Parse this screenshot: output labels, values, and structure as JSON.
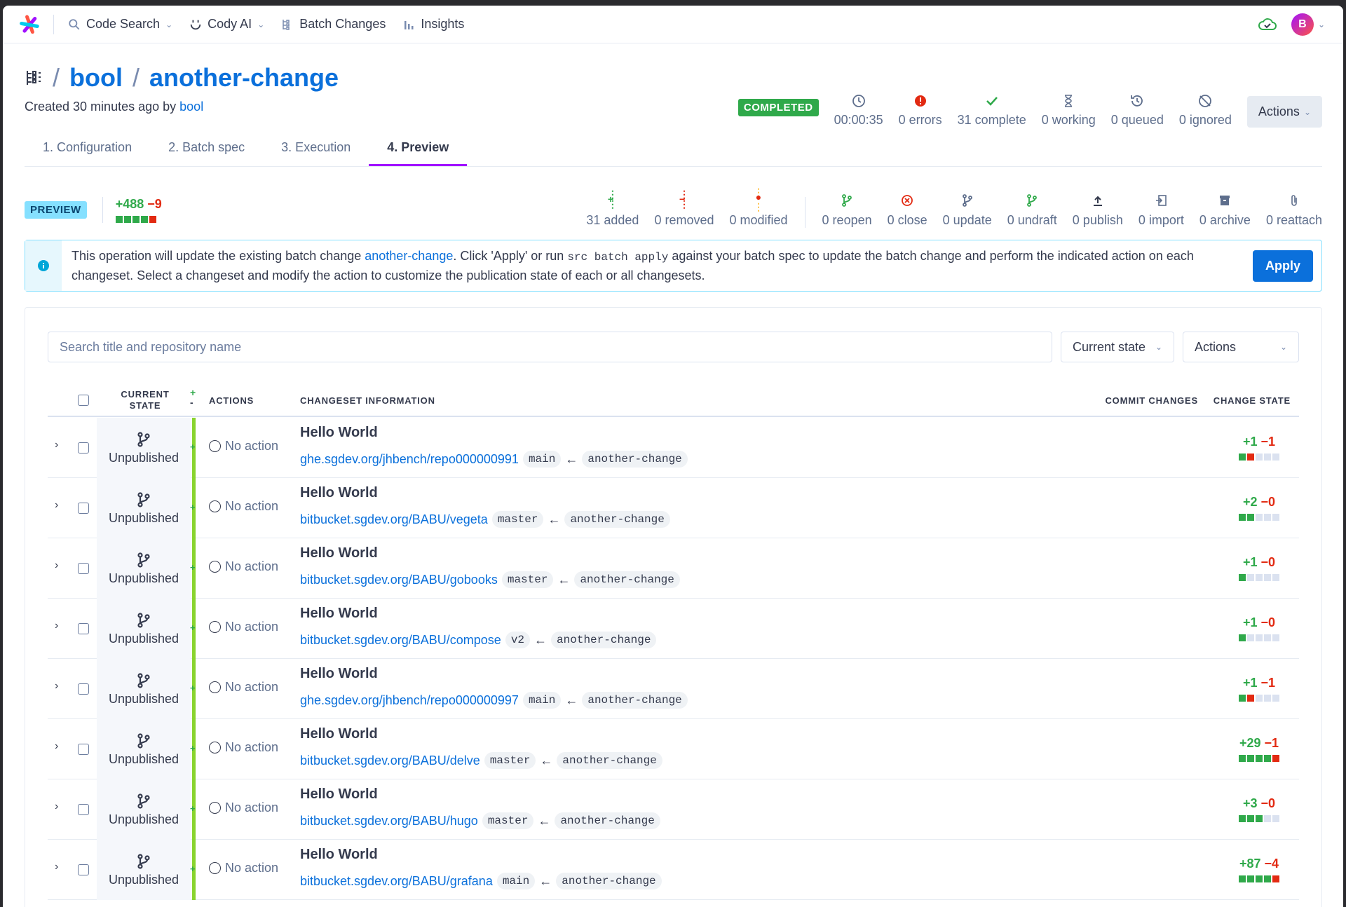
{
  "nav": {
    "items": [
      {
        "label": "Code Search",
        "icon": "search-icon",
        "dropdown": true
      },
      {
        "label": "Cody AI",
        "icon": "cody-icon",
        "dropdown": true
      },
      {
        "label": "Batch Changes",
        "icon": "batch-changes-icon",
        "dropdown": false
      },
      {
        "label": "Insights",
        "icon": "bar-chart-icon",
        "dropdown": false
      }
    ],
    "avatar_initial": "B"
  },
  "header": {
    "namespace": "bool",
    "name": "another-change",
    "created_prefix": "Created 30 minutes ago by",
    "created_by": "bool"
  },
  "execution": {
    "status": "COMPLETED",
    "duration": "00:00:35",
    "errors": "0 errors",
    "complete": "31 complete",
    "working": "0 working",
    "queued": "0 queued",
    "ignored": "0 ignored",
    "actions_label": "Actions"
  },
  "tabs": [
    "1. Configuration",
    "2. Batch spec",
    "3. Execution",
    "4. Preview"
  ],
  "active_tab": "4. Preview",
  "preview": {
    "badge": "PREVIEW",
    "added_lines": "+488",
    "removed_lines": "−9",
    "diffstat_blocks": [
      "g",
      "g",
      "g",
      "g",
      "r"
    ],
    "added": "31 added",
    "removed": "0 removed",
    "modified": "0 modified",
    "reopen": "0 reopen",
    "close": "0 close",
    "update": "0 update",
    "undraft": "0 undraft",
    "publish": "0 publish",
    "import": "0 import",
    "archive": "0 archive",
    "reattach": "0 reattach"
  },
  "alert": {
    "text1": "This operation will update the existing batch change ",
    "link": "another-change",
    "text2": ". Click 'Apply' or run ",
    "code": "src batch apply",
    "text3": " against your batch spec to update the batch change and perform the indicated action on each changeset. Select a changeset and modify the action to customize the publication state of each or all changesets.",
    "apply_label": "Apply"
  },
  "filters": {
    "search_placeholder": "Search title and repository name",
    "state_label": "Current state",
    "actions_label": "Actions"
  },
  "table": {
    "headers": {
      "current_state": "CURRENT STATE",
      "actions": "ACTIONS",
      "changeset_info": "CHANGESET INFORMATION",
      "commit_changes": "COMMIT CHANGES",
      "change_state": "CHANGE STATE"
    },
    "rows": [
      {
        "state": "Unpublished",
        "action": "No action",
        "title": "Hello World",
        "repo": "ghe.sgdev.org/jhbench/repo000000991",
        "base": "main",
        "head": "another-change",
        "added": "+1",
        "removed": "−1",
        "blocks": [
          "g",
          "r",
          "e",
          "e",
          "e"
        ]
      },
      {
        "state": "Unpublished",
        "action": "No action",
        "title": "Hello World",
        "repo": "bitbucket.sgdev.org/BABU/vegeta",
        "base": "master",
        "head": "another-change",
        "added": "+2",
        "removed": "−0",
        "blocks": [
          "g",
          "g",
          "e",
          "e",
          "e"
        ]
      },
      {
        "state": "Unpublished",
        "action": "No action",
        "title": "Hello World",
        "repo": "bitbucket.sgdev.org/BABU/gobooks",
        "base": "master",
        "head": "another-change",
        "added": "+1",
        "removed": "−0",
        "blocks": [
          "g",
          "e",
          "e",
          "e",
          "e"
        ]
      },
      {
        "state": "Unpublished",
        "action": "No action",
        "title": "Hello World",
        "repo": "bitbucket.sgdev.org/BABU/compose",
        "base": "v2",
        "head": "another-change",
        "added": "+1",
        "removed": "−0",
        "blocks": [
          "g",
          "e",
          "e",
          "e",
          "e"
        ]
      },
      {
        "state": "Unpublished",
        "action": "No action",
        "title": "Hello World",
        "repo": "ghe.sgdev.org/jhbench/repo000000997",
        "base": "main",
        "head": "another-change",
        "added": "+1",
        "removed": "−1",
        "blocks": [
          "g",
          "r",
          "e",
          "e",
          "e"
        ]
      },
      {
        "state": "Unpublished",
        "action": "No action",
        "title": "Hello World",
        "repo": "bitbucket.sgdev.org/BABU/delve",
        "base": "master",
        "head": "another-change",
        "added": "+29",
        "removed": "−1",
        "blocks": [
          "g",
          "g",
          "g",
          "g",
          "r"
        ]
      },
      {
        "state": "Unpublished",
        "action": "No action",
        "title": "Hello World",
        "repo": "bitbucket.sgdev.org/BABU/hugo",
        "base": "master",
        "head": "another-change",
        "added": "+3",
        "removed": "−0",
        "blocks": [
          "g",
          "g",
          "g",
          "e",
          "e"
        ]
      },
      {
        "state": "Unpublished",
        "action": "No action",
        "title": "Hello World",
        "repo": "bitbucket.sgdev.org/BABU/grafana",
        "base": "main",
        "head": "another-change",
        "added": "+87",
        "removed": "−4",
        "blocks": [
          "g",
          "g",
          "g",
          "g",
          "r"
        ]
      }
    ]
  },
  "colors": {
    "accent": "#0b70db",
    "success": "#2fa94a",
    "danger": "#e22a12",
    "active_tab": "#a112ff"
  }
}
